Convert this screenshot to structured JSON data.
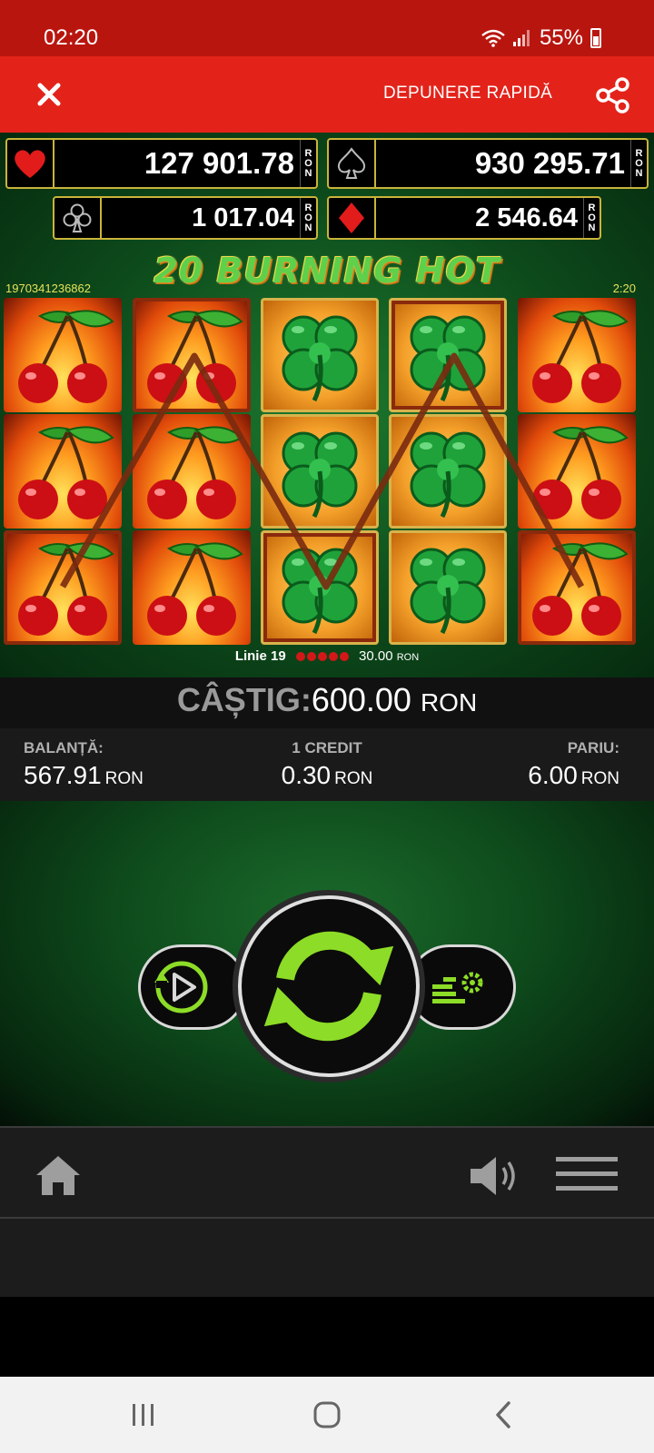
{
  "status_bar": {
    "time": "02:20",
    "battery": "55%"
  },
  "header": {
    "deposit_label": "DEPUNERE RAPIDĂ"
  },
  "jackpots": [
    {
      "suit": "heart",
      "value": "127 901.78",
      "currency": "RON"
    },
    {
      "suit": "spade",
      "value": "930 295.71",
      "currency": "RON"
    },
    {
      "suit": "club",
      "value": "1 017.04",
      "currency": "RON"
    },
    {
      "suit": "diamond",
      "value": "2 546.64",
      "currency": "RON"
    }
  ],
  "game": {
    "title": "20 BURNING HOT",
    "round_id": "1970341236862",
    "clock": "2:20",
    "reels": [
      [
        "cherry",
        "cherry",
        "cherry"
      ],
      [
        "cherry",
        "cherry",
        "cherry"
      ],
      [
        "clover",
        "clover",
        "clover"
      ],
      [
        "clover",
        "clover",
        "clover"
      ],
      [
        "cherry",
        "cherry",
        "cherry"
      ]
    ],
    "win_line": {
      "label": "Linie 19",
      "amount": "30.00",
      "currency": "RON"
    }
  },
  "win": {
    "label": "CÂȘTIG:",
    "value": "600.00",
    "currency": "RON"
  },
  "info": {
    "balance": {
      "label": "BALANȚĂ:",
      "value": "567.91",
      "currency": "RON"
    },
    "credit": {
      "label": "1 CREDIT",
      "value": "0.30",
      "currency": "RON"
    },
    "bet": {
      "label": "PARIU:",
      "value": "6.00",
      "currency": "RON"
    }
  },
  "icons": {
    "close": "close-icon",
    "share": "share-icon",
    "autoplay": "autoplay-icon",
    "spin": "spin-icon",
    "settings": "bet-settings-icon",
    "home": "home-icon",
    "sound": "sound-icon",
    "menu": "menu-icon",
    "recents": "recents-icon",
    "android_home": "android-home-icon",
    "back": "back-icon"
  },
  "colors": {
    "header_red": "#e3231a",
    "status_red": "#b9150f",
    "jackpot_border": "#c9b43a",
    "spin_green": "#8ddc27",
    "title_green": "#5ed04a"
  }
}
